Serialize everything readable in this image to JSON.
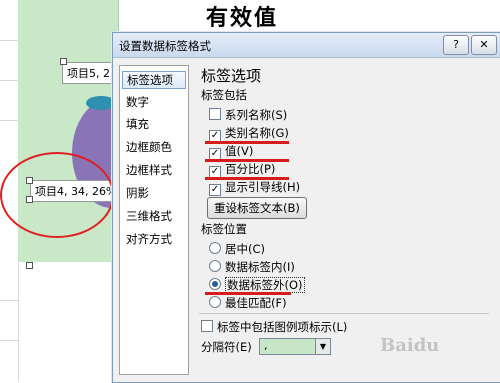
{
  "chart": {
    "title": "有效值",
    "label_top": "项目5, 2",
    "label_left": "项目4, 34, 26%"
  },
  "dialog": {
    "title": "设置数据标签格式",
    "help_button": "?",
    "close_button": "✕",
    "nav": [
      "标签选项",
      "数字",
      "填充",
      "边框颜色",
      "边框样式",
      "阴影",
      "三维格式",
      "对齐方式"
    ],
    "section_title": "标签选项",
    "label_contains": "标签包括",
    "options": [
      {
        "label": "系列名称(S)",
        "checked": false
      },
      {
        "label": "类别名称(G)",
        "checked": true
      },
      {
        "label": "值(V)",
        "checked": true
      },
      {
        "label": "百分比(P)",
        "checked": true
      },
      {
        "label": "显示引导线(H)",
        "checked": true
      }
    ],
    "reset_button": "重设标签文本(B)",
    "label_position": "标签位置",
    "positions": [
      {
        "label": "居中(C)",
        "selected": false
      },
      {
        "label": "数据标签内(I)",
        "selected": false
      },
      {
        "label": "数据标签外(O)",
        "selected": true
      },
      {
        "label": "最佳匹配(F)",
        "selected": false
      }
    ],
    "legend_key_option": "标签中包括图例项标示(L)",
    "separator_label": "分隔符(E)",
    "separator_value": ","
  },
  "watermark": "Baidu"
}
